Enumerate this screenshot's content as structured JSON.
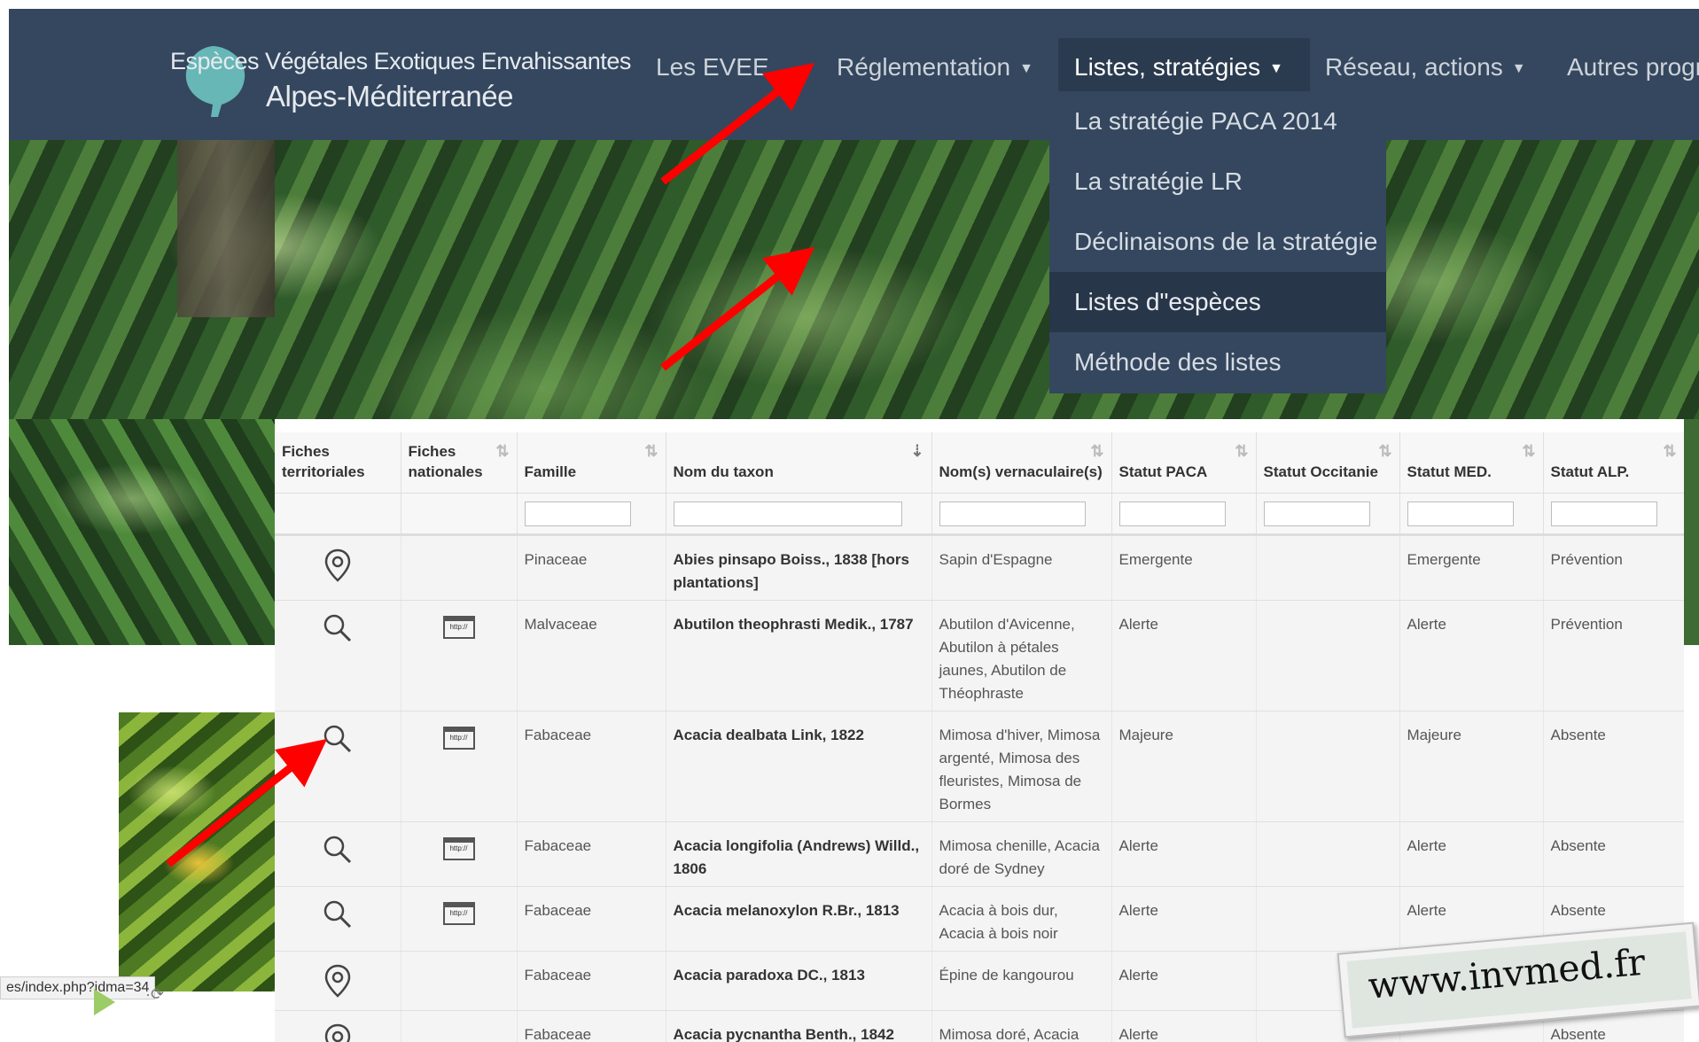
{
  "brand": {
    "line1": "Espèces Végétales Exotiques Envahissantes",
    "line2": "Alpes-Méditerranée"
  },
  "nav": {
    "items": [
      {
        "label": "Les EVEE",
        "active": false
      },
      {
        "label": "Réglementation",
        "active": false
      },
      {
        "label": "Listes, stratégies",
        "active": true
      },
      {
        "label": "Réseau, actions",
        "active": false
      },
      {
        "label": "Autres progra",
        "active": false
      }
    ]
  },
  "dropdown": {
    "items": [
      {
        "label": "La stratégie PACA 2014",
        "highlighted": false
      },
      {
        "label": "La stratégie LR",
        "highlighted": false
      },
      {
        "label": "Déclinaisons de la stratégie",
        "highlighted": false
      },
      {
        "label": "Listes d\"espèces",
        "highlighted": true
      },
      {
        "label": "Méthode des listes",
        "highlighted": false
      }
    ]
  },
  "table": {
    "headers": [
      {
        "label": "Fiches territoriales",
        "sortable": false
      },
      {
        "label": "Fiches nationales",
        "sortable": true
      },
      {
        "label": "Famille",
        "sortable": true
      },
      {
        "label": "Nom du taxon",
        "sortable": true,
        "sorted": true
      },
      {
        "label": "Nom(s) vernaculaire(s)",
        "sortable": true
      },
      {
        "label": "Statut PACA",
        "sortable": true
      },
      {
        "label": "Statut Occitanie",
        "sortable": true
      },
      {
        "label": "Statut MED.",
        "sortable": true
      },
      {
        "label": "Statut ALP.",
        "sortable": true
      }
    ],
    "rows": [
      {
        "fiche_territoriale": "location-pin-icon",
        "fiche_nationale": "",
        "famille": "Pinaceae",
        "taxon": "Abies pinsapo Boiss., 1838 [hors plantations]",
        "vernaculaire": "Sapin d'Espagne",
        "paca": "Emergente",
        "occitanie": "",
        "med": "Emergente",
        "alp": "Prévention"
      },
      {
        "fiche_territoriale": "search-icon",
        "fiche_nationale": "web-page-icon",
        "famille": "Malvaceae",
        "taxon": "Abutilon theophrasti Medik., 1787",
        "vernaculaire": "Abutilon d'Avicenne, Abutilon à pétales jaunes, Abutilon de Théophraste",
        "paca": "Alerte",
        "occitanie": "",
        "med": "Alerte",
        "alp": "Prévention"
      },
      {
        "fiche_territoriale": "search-icon",
        "fiche_nationale": "web-page-icon",
        "famille": "Fabaceae",
        "taxon": "Acacia dealbata Link, 1822",
        "vernaculaire": "Mimosa d'hiver, Mimosa argenté, Mimosa des fleuristes, Mimosa de Bormes",
        "paca": "Majeure",
        "occitanie": "",
        "med": "Majeure",
        "alp": "Absente"
      },
      {
        "fiche_territoriale": "search-icon",
        "fiche_nationale": "web-page-icon",
        "famille": "Fabaceae",
        "taxon": "Acacia longifolia (Andrews) Willd., 1806",
        "vernaculaire": "Mimosa chenille, Acacia doré de Sydney",
        "paca": "Alerte",
        "occitanie": "",
        "med": "Alerte",
        "alp": "Absente"
      },
      {
        "fiche_territoriale": "search-icon",
        "fiche_nationale": "web-page-icon",
        "famille": "Fabaceae",
        "taxon": "Acacia melanoxylon R.Br., 1813",
        "vernaculaire": "Acacia à bois dur, Acacia à bois noir",
        "paca": "Alerte",
        "occitanie": "",
        "med": "Alerte",
        "alp": "Absente"
      },
      {
        "fiche_territoriale": "location-pin-icon",
        "fiche_nationale": "",
        "famille": "Fabaceae",
        "taxon": "Acacia paradoxa DC., 1813",
        "vernaculaire": "Épine de kangourou",
        "paca": "Alerte",
        "occitanie": "",
        "med": "",
        "alp": ""
      },
      {
        "fiche_territoriale": "location-pin-icon",
        "fiche_nationale": "",
        "famille": "Fabaceae",
        "taxon": "Acacia pycnantha Benth., 1842",
        "vernaculaire": "Mimosa doré, Acacia doré",
        "paca": "Alerte",
        "occitanie": "",
        "med": "",
        "alp": "Absente"
      }
    ]
  },
  "web_icon_text": "http://",
  "status_url": "es/index.php?idma=34",
  "watermark": "www.invmed.fr",
  "colors": {
    "navbar": "#34475e",
    "dropdown_highlight": "#273648",
    "arrow": "#ff0000",
    "logo_leaf": "#6cc3c0"
  }
}
